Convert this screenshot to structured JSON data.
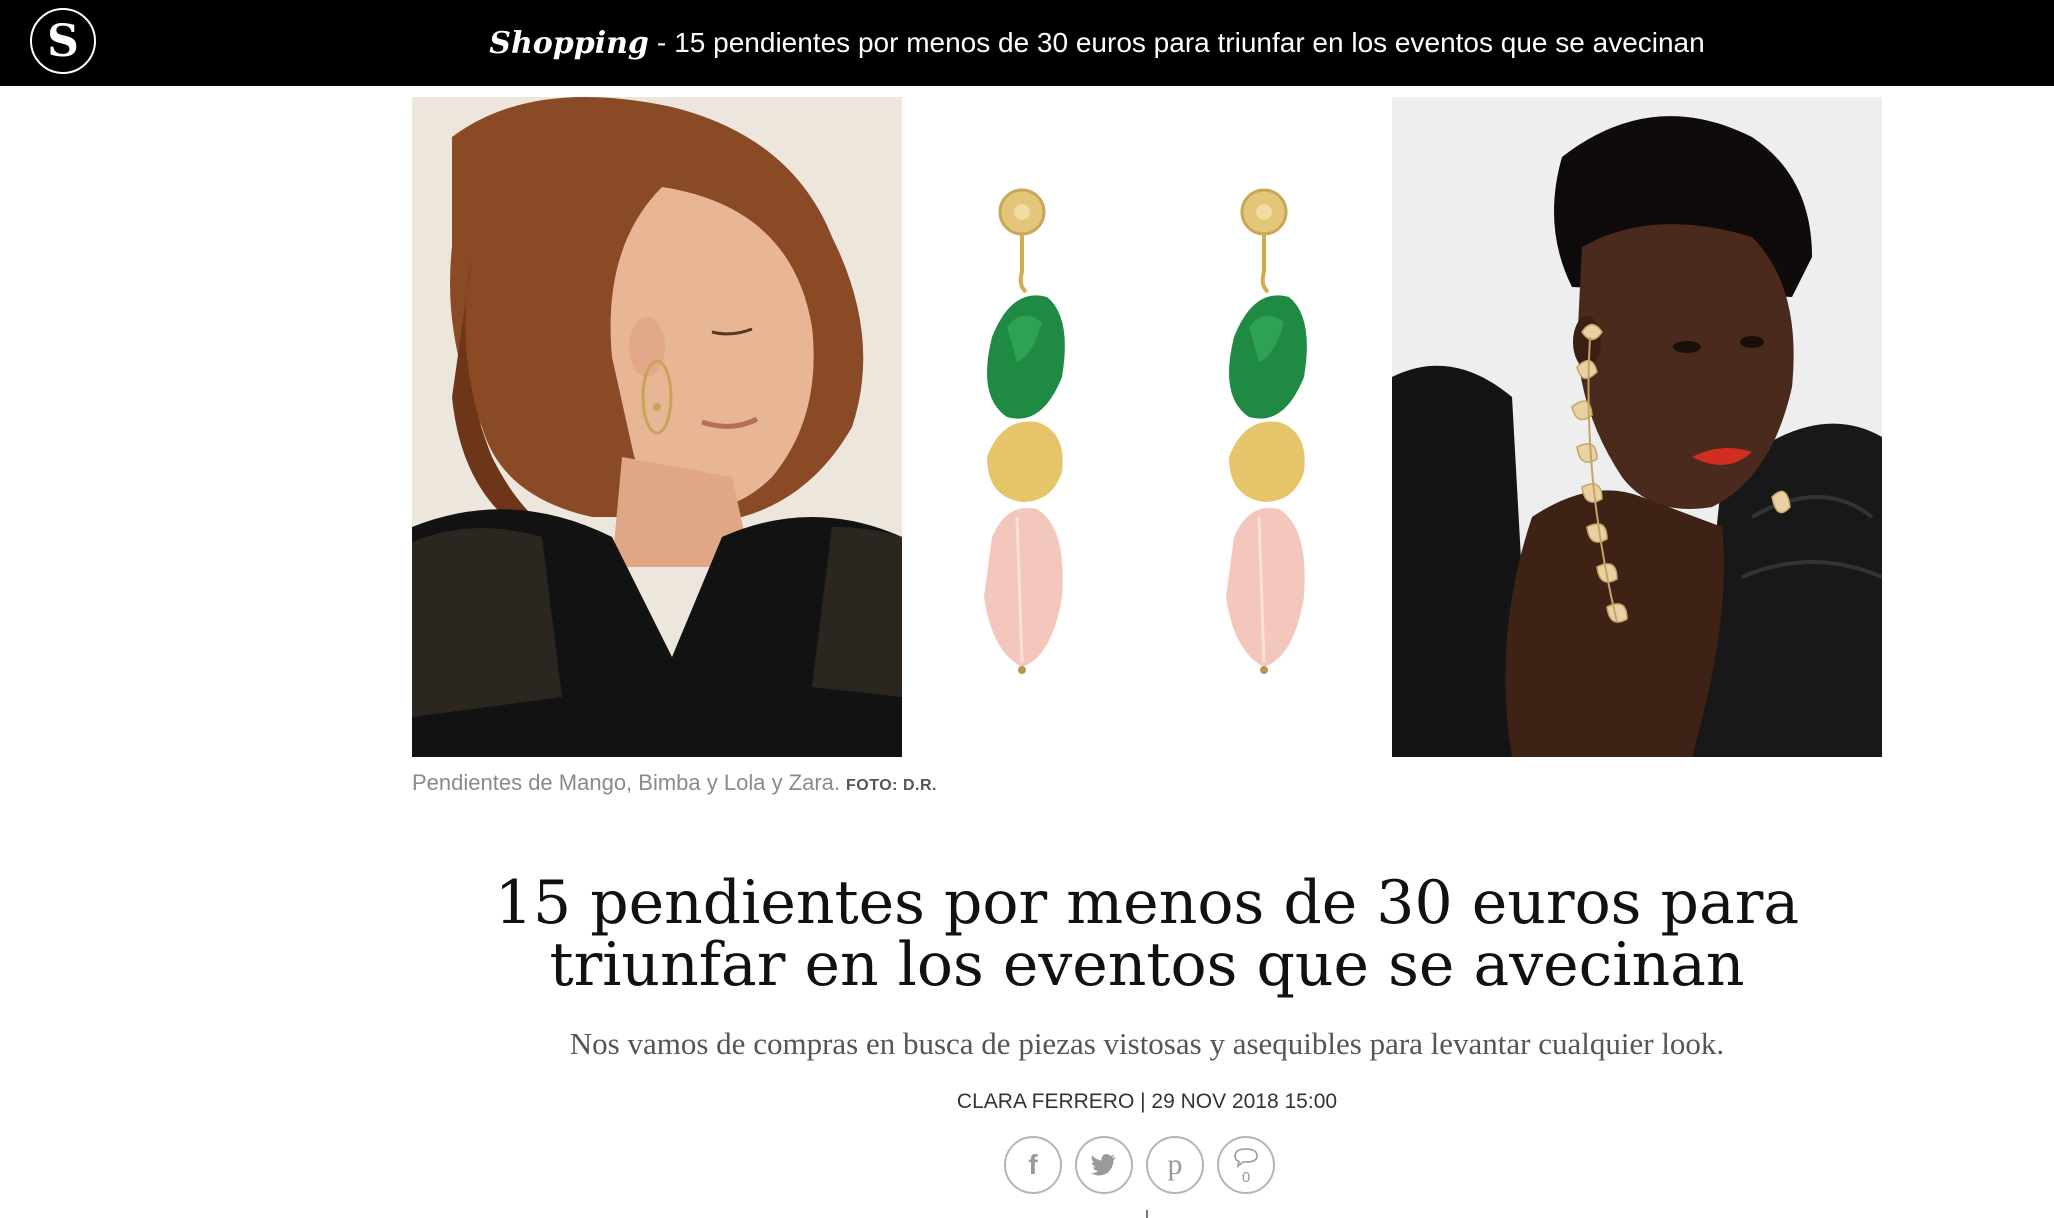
{
  "header": {
    "logo_letter": "S",
    "section": "Shopping",
    "separator": "-",
    "headline": "15 pendientes por menos de 30 euros para triunfar en los eventos que se avecinan"
  },
  "hero": {
    "caption": "Pendientes de Mango, Bimba y Lola y Zara.",
    "credit": "FOTO: D.R."
  },
  "article": {
    "title": "15 pendientes por menos de 30 euros para triunfar en los eventos que se avecinan",
    "subtitle": "Nos vamos de compras en busca de piezas vistosas y asequibles para levantar cualquier look.",
    "byline": "CLARA FERRERO | 29 NOV 2018 15:00"
  },
  "share": {
    "facebook_icon": "f",
    "twitter_icon": "twitter-bird",
    "pinterest_icon": "p",
    "comments_icon": "speech-bubble",
    "comments_count": "0"
  }
}
